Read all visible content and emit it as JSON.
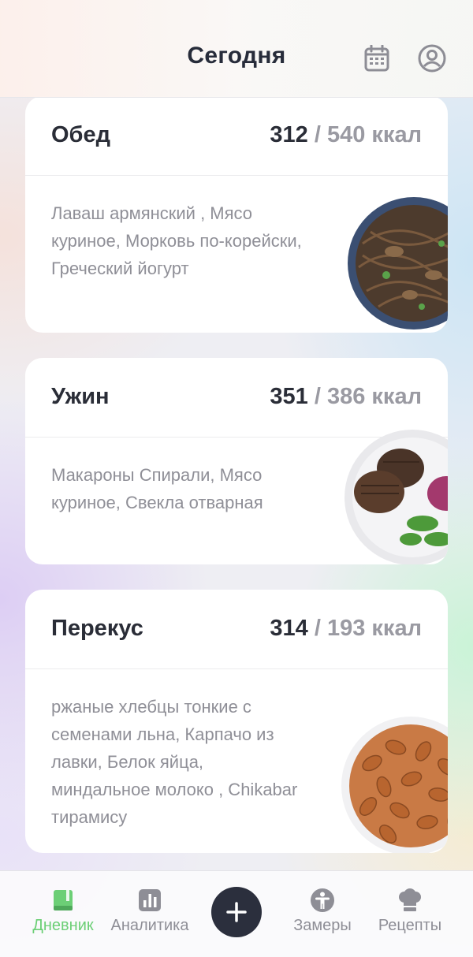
{
  "header": {
    "title": "Сегодня"
  },
  "meals": [
    {
      "name": "Обед",
      "eaten": "312",
      "separator": " / ",
      "goal": "540 ккал",
      "foods": "Лаваш армянский , Мясо куриное, Морковь по-корейски, Греческий йогурт"
    },
    {
      "name": "Ужин",
      "eaten": "351",
      "separator": " / ",
      "goal": "386 ккал",
      "foods": "Макароны Спирали, Мясо куриное, Свекла отварная"
    },
    {
      "name": "Перекус",
      "eaten": "314",
      "separator": " / ",
      "goal": "193 ккал",
      "foods": "ржаные хлебцы тонкие с семенами льна, Карпачо из лавки, Белок яйца, миндальное молоко , Chikabar тирамису"
    }
  ],
  "nav": {
    "diary": "Дневник",
    "analytics": "Аналитика",
    "measurements": "Замеры",
    "recipes": "Рецепты"
  },
  "colors": {
    "accent_green": "#6ccf76",
    "dark": "#2b2f3d",
    "muted": "#8e8e96"
  },
  "icons": [
    "calendar-icon",
    "profile-icon",
    "diary-book-icon",
    "analytics-chart-icon",
    "plus-icon",
    "measurements-person-icon",
    "recipes-chef-hat-icon"
  ]
}
